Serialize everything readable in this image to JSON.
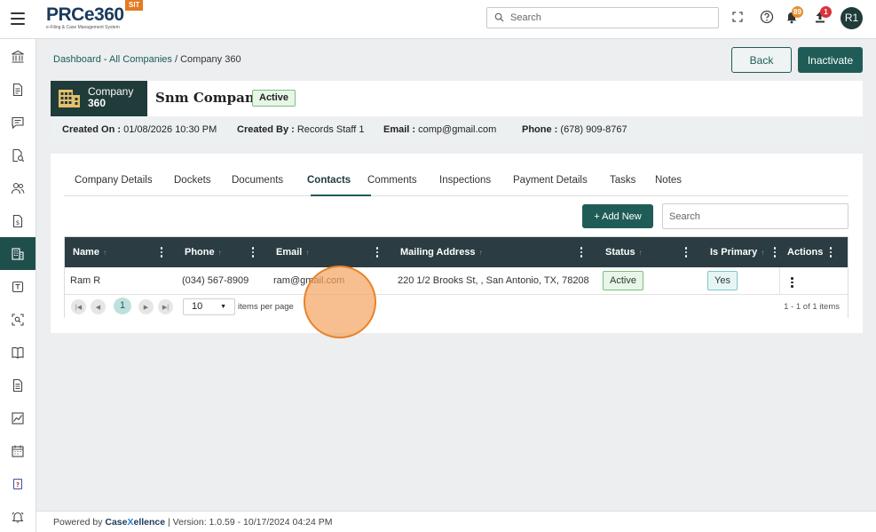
{
  "app": {
    "logo_main": "PRCe360",
    "logo_sub": "e-Filing & Case Management System",
    "env_badge": "SIT"
  },
  "topbar": {
    "search_placeholder": "Search",
    "notifications_count": "89",
    "uploads_count": "1",
    "avatar_initials": "R1",
    "colors": {
      "notif_badge": "#e38f2e",
      "upload_badge": "#d9333b",
      "avatar": "#1f3b3a"
    }
  },
  "sidebar": {
    "items": [
      {
        "icon": "bank-icon"
      },
      {
        "icon": "document-icon"
      },
      {
        "icon": "chat-icon"
      },
      {
        "icon": "document-search-icon"
      },
      {
        "icon": "users-icon"
      },
      {
        "icon": "dollar-document-icon"
      },
      {
        "icon": "building-icon",
        "active": true
      },
      {
        "icon": "tablet-icon"
      },
      {
        "icon": "scan-icon"
      },
      {
        "icon": "book-icon"
      },
      {
        "icon": "file-text-icon"
      },
      {
        "icon": "chart-icon"
      },
      {
        "icon": "calendar-icon"
      },
      {
        "icon": "help-book-icon"
      },
      {
        "icon": "alarm-icon"
      }
    ]
  },
  "breadcrumb": {
    "dashboard": "Dashboard",
    "sep1": " - ",
    "all_companies": "All Companies",
    "sep2": " / ",
    "current": "Company 360"
  },
  "actions": {
    "back": "Back",
    "inactivate": "Inactivate"
  },
  "company": {
    "tile_line1": "Company",
    "tile_line2": "360",
    "name": "Snm Company",
    "status": "Active",
    "created_on_label": "Created On :",
    "created_on": "01/08/2026 10:30 PM",
    "created_by_label": "Created By :",
    "created_by": "Records Staff 1",
    "email_label": "Email :",
    "email": "comp@gmail.com",
    "phone_label": "Phone :",
    "phone": "(678) 909-8767"
  },
  "tabs": [
    {
      "label": "Company Details"
    },
    {
      "label": "Dockets"
    },
    {
      "label": "Documents"
    },
    {
      "label": "Contacts",
      "active": true
    },
    {
      "label": "Comments"
    },
    {
      "label": "Inspections"
    },
    {
      "label": "Payment Details"
    },
    {
      "label": "Tasks"
    },
    {
      "label": "Notes"
    }
  ],
  "contacts": {
    "add_new": "+ Add New",
    "search_placeholder": "Search",
    "columns": {
      "name": "Name",
      "phone": "Phone",
      "email": "Email",
      "address": "Mailing Address",
      "status": "Status",
      "primary": "Is Primary",
      "actions": "Actions"
    },
    "rows": [
      {
        "name": "Ram R",
        "phone": "(034) 567-8909",
        "email": "ram@gmail.com",
        "address": "220 1/2 Brooks St, , San Antonio, TX, 78208",
        "status": "Active",
        "primary": "Yes"
      }
    ],
    "pager": {
      "page": "1",
      "page_size": "10",
      "per_page_label": "items per page",
      "info": "1 - 1 of 1 items"
    }
  },
  "footer": {
    "powered_by": "Powered by",
    "brand_case": "Case",
    "brand_x": "X",
    "brand_rest": "ellence",
    "version": "|  Version: 1.0.59 - 10/17/2024 04:24 PM"
  }
}
